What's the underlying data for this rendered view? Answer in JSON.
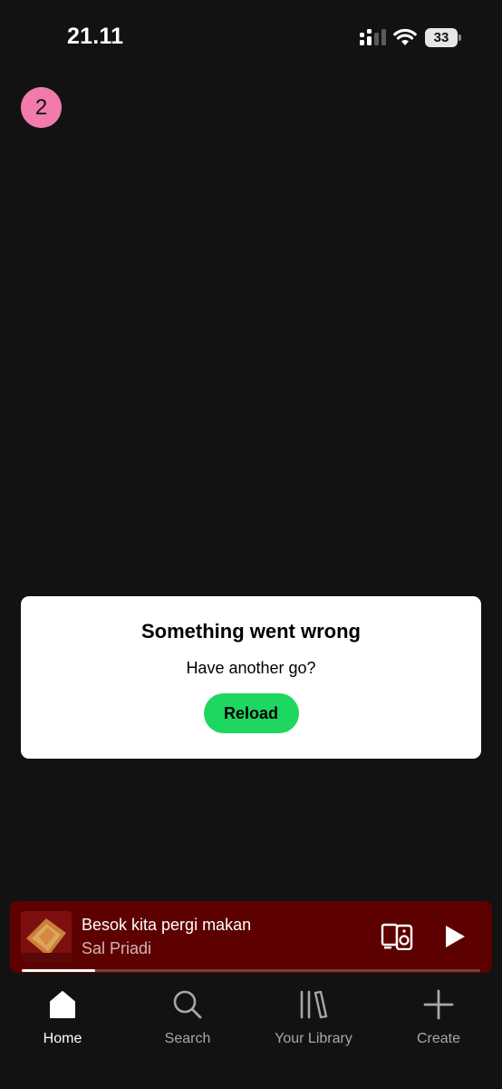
{
  "status_bar": {
    "time": "21.11",
    "battery_level": "33"
  },
  "profile": {
    "avatar_letter": "2",
    "avatar_color": "#f17bab"
  },
  "error_card": {
    "title": "Something went wrong",
    "subtitle": "Have another go?",
    "reload_label": "Reload",
    "button_color": "#1ed760"
  },
  "now_playing": {
    "title": "Besok kita pergi makan",
    "artist": "Sal Priadi",
    "progress": 0.16,
    "background_color": "#5d0000",
    "device_icon": "connect-devices-icon",
    "play_icon": "play-icon"
  },
  "nav": {
    "items": [
      {
        "label": "Home",
        "icon": "home-icon",
        "active": true
      },
      {
        "label": "Search",
        "icon": "search-icon",
        "active": false
      },
      {
        "label": "Your Library",
        "icon": "library-icon",
        "active": false
      },
      {
        "label": "Create",
        "icon": "plus-icon",
        "active": false
      }
    ]
  },
  "colors": {
    "background": "#121212",
    "accent_green": "#1ed760"
  }
}
